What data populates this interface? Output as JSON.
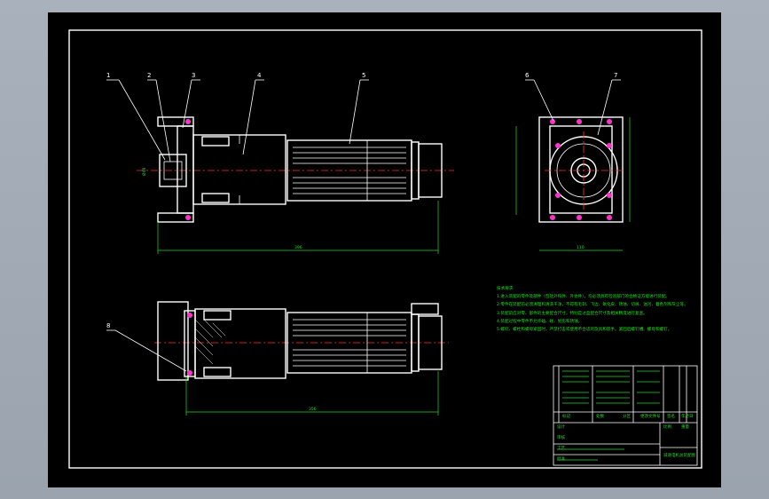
{
  "drawing": {
    "part_labels": [
      "1",
      "2",
      "3",
      "4",
      "5",
      "6",
      "7",
      "8"
    ],
    "tech_requirements": {
      "title": "技术要求",
      "lines": [
        "1.进入装配的零件及部件（包括外购件、外协件），均必须具有检验部门的合格证方能进行装配。",
        "2.零件在装配前必须清理和清洗干净，不得有毛刺、飞边、氧化皮、锈蚀、切屑、油污、着色剂和灰尘等。",
        "3.装配前应对零、部件的主要配合尺寸，特别是过盈配合尺寸及相关精度进行复查。",
        "4.装配过程中零件不允许磕、碰、划伤和锈蚀。",
        "5.螺钉、螺栓和螺母紧固时，严禁打击或使用不合适的旋具和扳手。紧固后螺钉槽、螺母和螺钉。"
      ]
    },
    "title_block": {
      "drawing_name": "减速电机总装配图",
      "labels": [
        "标记",
        "处数",
        "分区",
        "更改文件号",
        "签名",
        "年月日"
      ],
      "row_labels": [
        "设计",
        "审核",
        "工艺",
        "批准"
      ],
      "scale_label": "比例",
      "weight_label": "重量"
    }
  }
}
